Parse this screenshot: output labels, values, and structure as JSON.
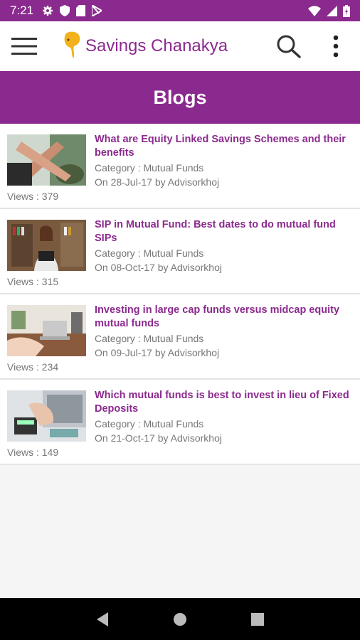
{
  "status_bar": {
    "time": "7:21"
  },
  "app_bar": {
    "title": "Savings Chanakya"
  },
  "page": {
    "heading": "Blogs"
  },
  "blogs": [
    {
      "title": "What are Equity Linked Savings Schemes and their benefits",
      "category": "Category : Mutual Funds",
      "date": "On 28-Jul-17 by Advisorkhoj",
      "views": "Views : 379"
    },
    {
      "title": "SIP in Mutual Fund: Best dates to do mutual fund SIPs",
      "category": "Category : Mutual Funds",
      "date": "On 08-Oct-17 by Advisorkhoj",
      "views": "Views : 315"
    },
    {
      "title": "Investing in large cap funds versus midcap equity mutual funds",
      "category": "Category : Mutual Funds",
      "date": "On 09-Jul-17 by Advisorkhoj",
      "views": "Views : 234"
    },
    {
      "title": "Which mutual funds is best to invest in lieu of Fixed Deposits",
      "category": "Category : Mutual Funds",
      "date": "On 21-Oct-17 by Advisorkhoj",
      "views": "Views : 149"
    }
  ],
  "colors": {
    "primary": "#8b2a8e",
    "logo": "#f2b21c",
    "text_secondary": "#777777"
  }
}
